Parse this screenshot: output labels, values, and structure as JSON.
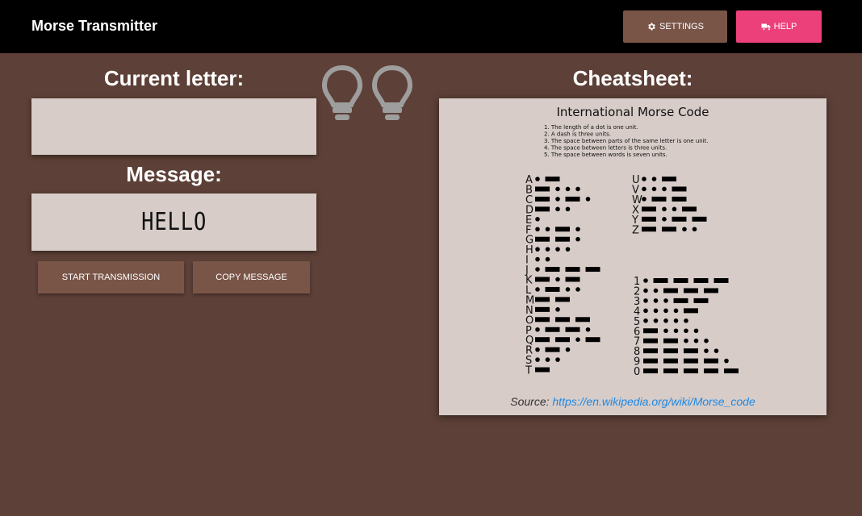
{
  "app": {
    "title": "Morse Transmitter"
  },
  "nav": {
    "settings_label": "SETTINGS",
    "help_label": "HELP"
  },
  "current_letter": {
    "heading": "Current letter:",
    "value": ""
  },
  "message": {
    "heading": "Message:",
    "value": "HELLO"
  },
  "actions": {
    "start_label": "START TRANSMISSION",
    "copy_label": "COPY MESSAGE"
  },
  "cheatsheet": {
    "heading": "Cheatsheet:",
    "chart_title": "International Morse Code",
    "rules": [
      "1. The length of a dot is one unit.",
      "2. A dash is three units.",
      "3. The space between parts of the same letter is one unit.",
      "4. The space between letters is three units.",
      "5. The space between words is seven units."
    ],
    "letters": [
      {
        "char": "A",
        "code": ".-"
      },
      {
        "char": "B",
        "code": "-..."
      },
      {
        "char": "C",
        "code": "-.-."
      },
      {
        "char": "D",
        "code": "-.."
      },
      {
        "char": "E",
        "code": "."
      },
      {
        "char": "F",
        "code": "..-."
      },
      {
        "char": "G",
        "code": "--."
      },
      {
        "char": "H",
        "code": "...."
      },
      {
        "char": "I",
        "code": ".."
      },
      {
        "char": "J",
        "code": ".---"
      },
      {
        "char": "K",
        "code": "-.-"
      },
      {
        "char": "L",
        "code": ".-.."
      },
      {
        "char": "M",
        "code": "--"
      },
      {
        "char": "N",
        "code": "-."
      },
      {
        "char": "O",
        "code": "---"
      },
      {
        "char": "P",
        "code": ".--."
      },
      {
        "char": "Q",
        "code": "--.-"
      },
      {
        "char": "R",
        "code": ".-."
      },
      {
        "char": "S",
        "code": "..."
      },
      {
        "char": "T",
        "code": "-"
      }
    ],
    "letters2": [
      {
        "char": "U",
        "code": "..-"
      },
      {
        "char": "V",
        "code": "...-"
      },
      {
        "char": "W",
        "code": ".--"
      },
      {
        "char": "X",
        "code": "-..-"
      },
      {
        "char": "Y",
        "code": "-.--"
      },
      {
        "char": "Z",
        "code": "--.."
      }
    ],
    "digits": [
      {
        "char": "1",
        "code": ".----"
      },
      {
        "char": "2",
        "code": "..---"
      },
      {
        "char": "3",
        "code": "...--"
      },
      {
        "char": "4",
        "code": "....-"
      },
      {
        "char": "5",
        "code": "....."
      },
      {
        "char": "6",
        "code": "-...."
      },
      {
        "char": "7",
        "code": "--..."
      },
      {
        "char": "8",
        "code": "---.."
      },
      {
        "char": "9",
        "code": "----."
      },
      {
        "char": "0",
        "code": "-----"
      }
    ],
    "source_prefix": "Source: ",
    "source_link": "https://en.wikipedia.org/wiki/Morse_code"
  },
  "colors": {
    "topbar": "#000000",
    "background": "#5d4037",
    "panel": "#d7ccc8",
    "button": "#795548",
    "help": "#ec407a",
    "link": "#1e88e5"
  },
  "icons": {
    "settings": "gear-icon",
    "help": "truck-icon",
    "bulbs": "lightbulb-icon"
  }
}
